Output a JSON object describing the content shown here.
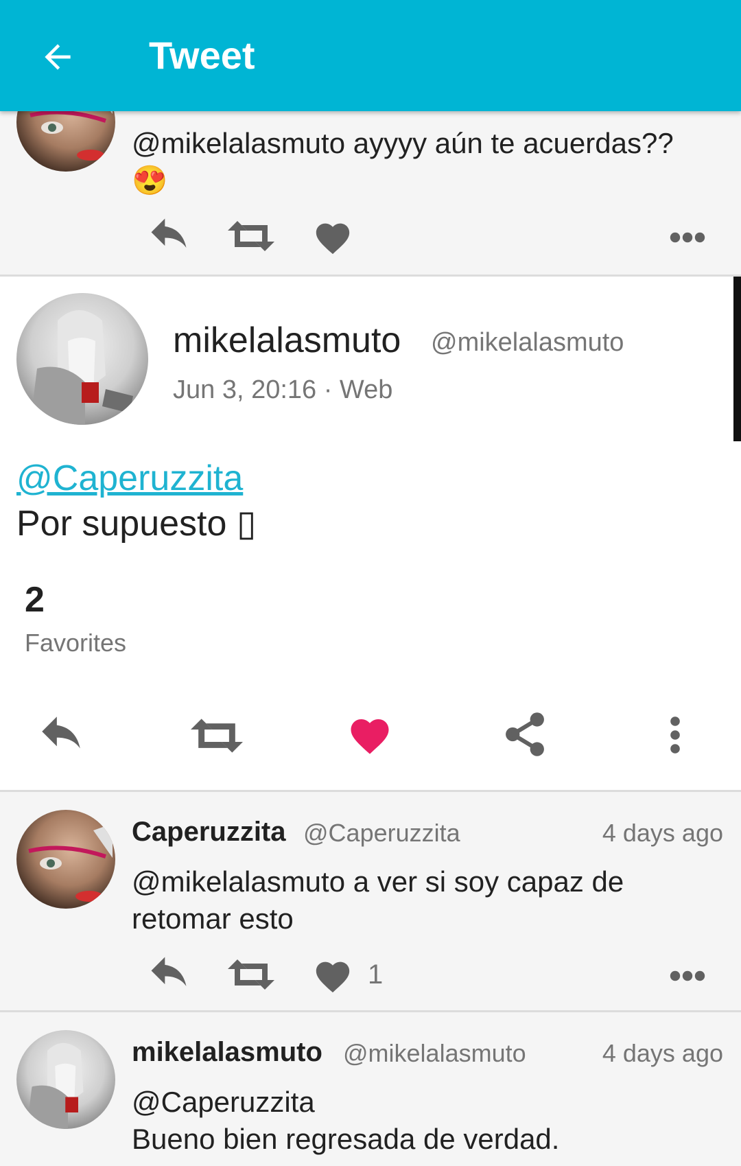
{
  "appbar": {
    "title": "Tweet"
  },
  "prev_tweet": {
    "text": "@mikelalasmuto ayyyy aún te acuerdas??",
    "emoji": "😍"
  },
  "main_tweet": {
    "name": "mikelalasmuto",
    "handle": "@mikelalasmuto",
    "meta": "Jun 3, 20:16 · Web",
    "mention": "@Caperuzzita",
    "text": "Por supuesto ▯",
    "favorites_count": "2",
    "favorites_label": "Favorites"
  },
  "reply1": {
    "name": "Caperuzzita",
    "handle": "@Caperuzzita",
    "time": "4 days ago",
    "text_line1": "@mikelalasmuto a ver si soy capaz de",
    "text_line2": "retomar esto",
    "like_count": "1"
  },
  "reply2": {
    "name": "mikelalasmuto",
    "handle": "@mikelalasmuto",
    "time": "4 days ago",
    "text_line1": "@Caperuzzita",
    "text_line2": "Bueno bien regresada de verdad."
  },
  "colors": {
    "accent": "#00b5d4",
    "like": "#e91e63",
    "icon": "#616161"
  }
}
